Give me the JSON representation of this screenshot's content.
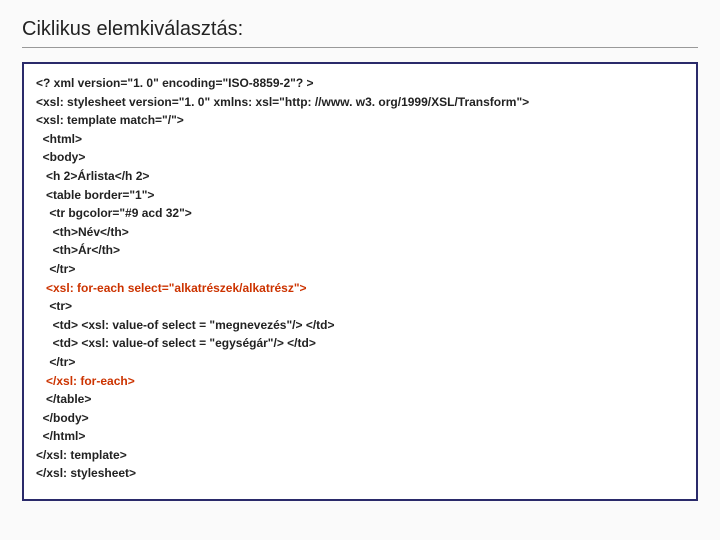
{
  "title": "Ciklikus elemkiválasztás:",
  "code": {
    "l1": "<? xml version=\"1. 0\" encoding=\"ISO-8859-2\"? >",
    "l2": "<xsl: stylesheet version=\"1. 0\" xmlns: xsl=\"http: //www. w3. org/1999/XSL/Transform\">",
    "l3": "<xsl: template match=\"/\">",
    "l4": "  <html>",
    "l5": "  <body>",
    "l6": "   <h 2>Árlista</h 2>",
    "l7": "   <table border=\"1\">",
    "l8": "    <tr bgcolor=\"#9 acd 32\">",
    "l9": "     <th>Név</th>",
    "l10": "     <th>Ár</th>",
    "l11": "    </tr>",
    "l12": "   <xsl: for-each select=\"alkatrészek/alkatrész\">",
    "l13": "    <tr>",
    "l14": "     <td> <xsl: value-of select = \"megnevezés\"/> </td>",
    "l15": "     <td> <xsl: value-of select = \"egységár\"/> </td>",
    "l16": "    </tr>",
    "l17": "   </xsl: for-each>",
    "l18": "   </table>",
    "l19": "  </body>",
    "l20": "  </html>",
    "l21": "</xsl: template>",
    "l22": "</xsl: stylesheet>"
  }
}
